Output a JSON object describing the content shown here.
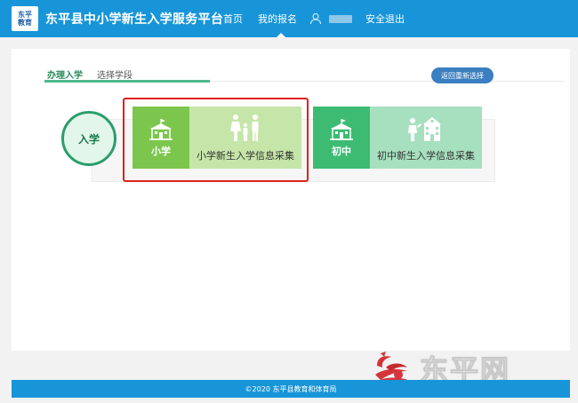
{
  "header": {
    "logo_line1": "东平",
    "logo_line2": "教育",
    "site_title": "东平县中小学新生入学服务平台",
    "nav_home": "首页",
    "nav_registration": "我的报名",
    "nav_logout": "安全退出"
  },
  "tabs": {
    "active": "办理入学",
    "other": "选择学段"
  },
  "buttons": {
    "return_label": "返回重新选择"
  },
  "enroll": {
    "circle_label": "入学",
    "primary_tag": "小学",
    "primary_title": "小学新生入学信息采集",
    "junior_tag": "初中",
    "junior_title": "初中新生入学信息采集"
  },
  "footer": {
    "copyright": "©2020 东平县教育和体育局"
  },
  "watermark": {
    "text": "东平网"
  },
  "colors": {
    "header_blue": "#1795d8",
    "primary_green": "#7cc64e",
    "junior_green": "#3dbb73",
    "highlight_red": "#e02020"
  }
}
